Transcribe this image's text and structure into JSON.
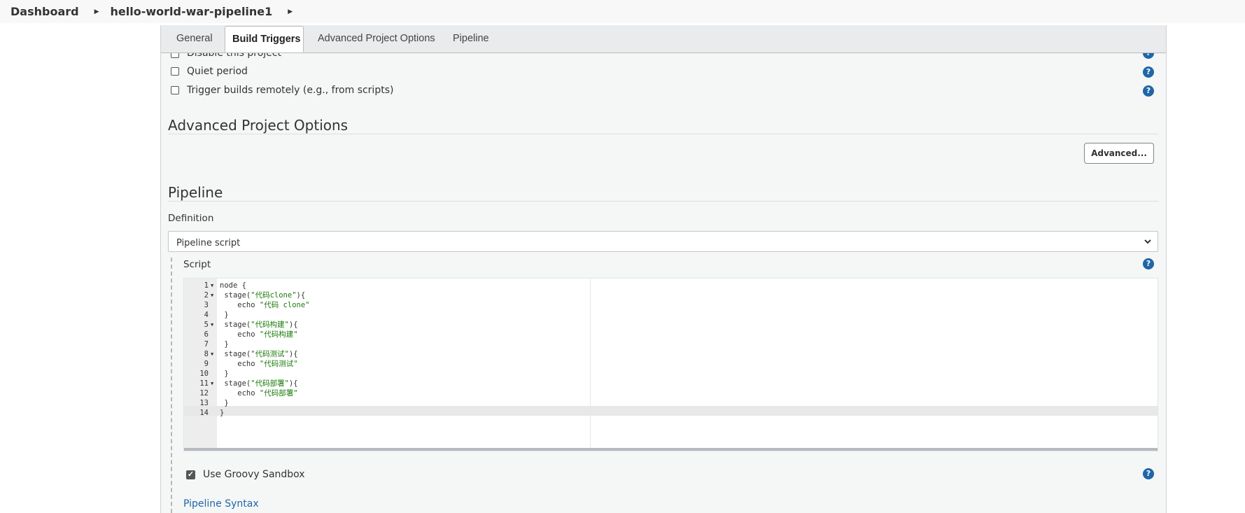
{
  "breadcrumb": {
    "items": [
      "Dashboard",
      "hello-world-war-pipeline1"
    ]
  },
  "tabs": [
    {
      "label": "General"
    },
    {
      "label": "Build Triggers",
      "active": true
    },
    {
      "label": "Advanced Project Options"
    },
    {
      "label": "Pipeline"
    }
  ],
  "build_triggers": {
    "disable_project": "Disable this project",
    "quiet_period": "Quiet period",
    "trigger_remotely": "Trigger builds remotely (e.g., from scripts)"
  },
  "advanced_options": {
    "title": "Advanced Project Options",
    "button_label": "Advanced..."
  },
  "pipeline": {
    "title": "Pipeline",
    "definition_label": "Definition",
    "definition_value": "Pipeline script",
    "script_label": "Script",
    "script_lines": [
      {
        "n": "1",
        "fold": true,
        "text": "node {"
      },
      {
        "n": "2",
        "fold": true,
        "pre": " stage(",
        "str": "\"代码clone\"",
        "post": "){"
      },
      {
        "n": "3",
        "fold": false,
        "pre": "    echo ",
        "str": "\"代码 clone\"",
        "post": ""
      },
      {
        "n": "4",
        "fold": false,
        "text": " }"
      },
      {
        "n": "5",
        "fold": true,
        "pre": " stage(",
        "str": "\"代码构建\"",
        "post": "){"
      },
      {
        "n": "6",
        "fold": false,
        "pre": "    echo ",
        "str": "\"代码构建\"",
        "post": ""
      },
      {
        "n": "7",
        "fold": false,
        "text": " }"
      },
      {
        "n": "8",
        "fold": true,
        "pre": " stage(",
        "str": "\"代码测试\"",
        "post": "){"
      },
      {
        "n": "9",
        "fold": false,
        "pre": "    echo ",
        "str": "\"代码测试\"",
        "post": ""
      },
      {
        "n": "10",
        "fold": false,
        "text": " }"
      },
      {
        "n": "11",
        "fold": true,
        "pre": " stage(",
        "str": "\"代码部署\"",
        "post": "){"
      },
      {
        "n": "12",
        "fold": false,
        "pre": "    echo ",
        "str": "\"代码部署\"",
        "post": ""
      },
      {
        "n": "13",
        "fold": false,
        "text": " }"
      },
      {
        "n": "14",
        "fold": false,
        "text": "}"
      }
    ],
    "sandbox_label": "Use Groovy Sandbox",
    "sandbox_checked": true,
    "syntax_link": "Pipeline Syntax"
  },
  "colors": {
    "help_icon": "#1f66a8",
    "link": "#1f66a8",
    "string_literal": "#1a7a0a"
  }
}
